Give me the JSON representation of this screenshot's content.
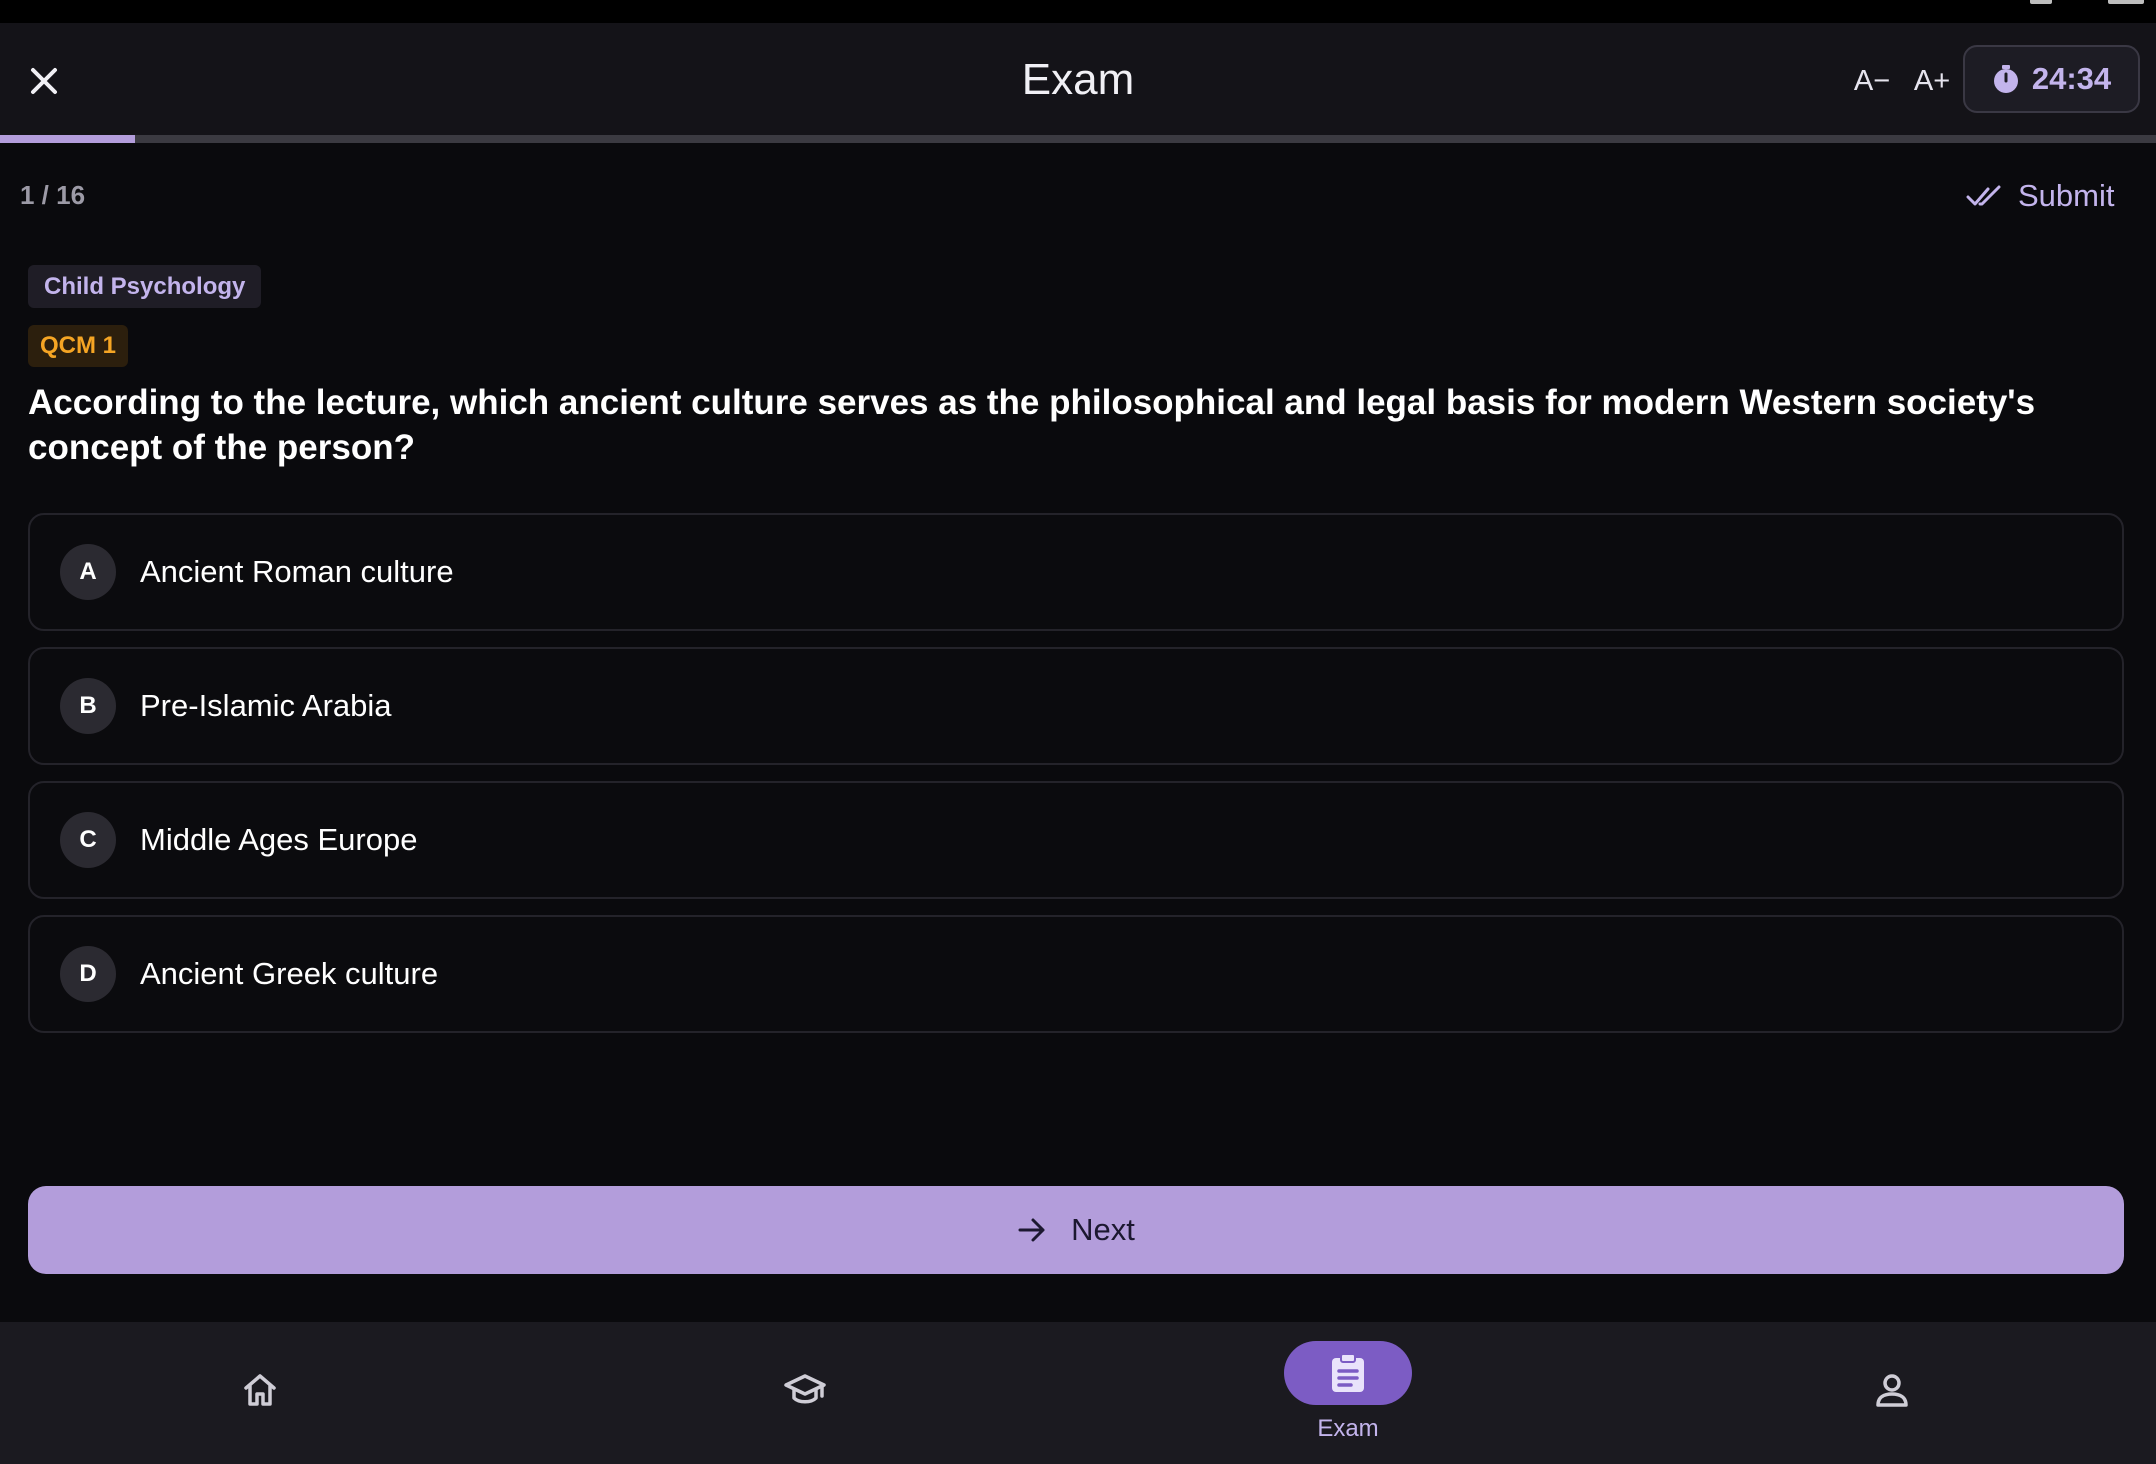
{
  "app_bar": {
    "title": "Exam",
    "font_decrease_label": "A−",
    "font_increase_label": "A+",
    "timer": "24:34"
  },
  "progress": {
    "current": 1,
    "total": 16,
    "fraction": 0.0625
  },
  "counter_text": "1 / 16",
  "submit_label": "Submit",
  "course_chip": "Child Psychology",
  "question_type": "QCM 1",
  "question_text": "According to the lecture, which ancient culture serves as the philosophical and legal basis for modern Western society's concept of the person?",
  "options": [
    {
      "letter": "A",
      "text": "Ancient Roman culture"
    },
    {
      "letter": "B",
      "text": "Pre-Islamic Arabia"
    },
    {
      "letter": "C",
      "text": "Middle Ages Europe"
    },
    {
      "letter": "D",
      "text": "Ancient Greek culture"
    }
  ],
  "next_label": "Next",
  "bottom_nav": {
    "items": [
      {
        "icon": "home-icon",
        "label": ""
      },
      {
        "icon": "graduation-cap-icon",
        "label": ""
      },
      {
        "icon": "clipboard-icon",
        "label": "Exam",
        "active": true
      },
      {
        "icon": "person-icon",
        "label": ""
      }
    ]
  },
  "colors": {
    "accent": "#b39ddb",
    "accent_text": "#c3b4ec",
    "active_nav_pill": "#7c5cc4",
    "question_type_text": "#f5a524",
    "background": "#0a0a0d"
  }
}
